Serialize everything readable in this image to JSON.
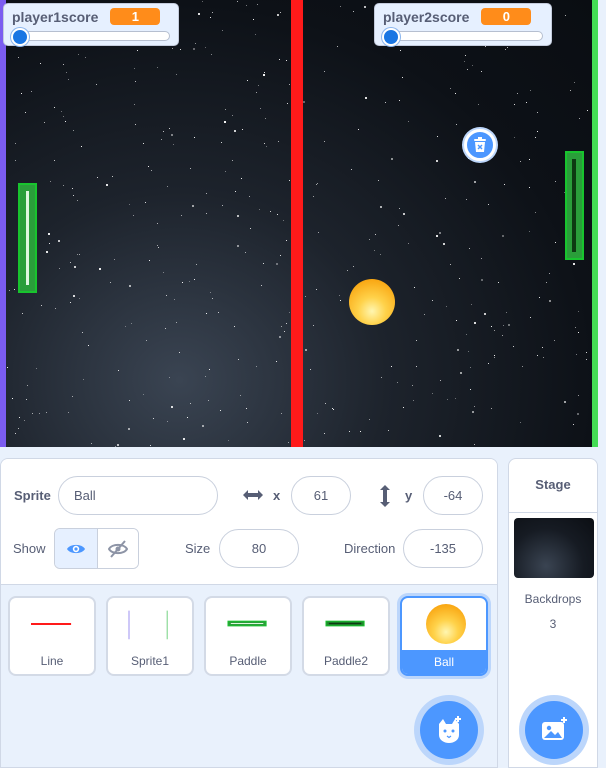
{
  "stage": {
    "monitors": [
      {
        "label": "player1score",
        "value": "1"
      },
      {
        "label": "player2score",
        "value": "0"
      }
    ],
    "sprites_on_stage": [
      "Line",
      "Paddle",
      "Paddle2",
      "Ball"
    ]
  },
  "sprite_info": {
    "sprite_label": "Sprite",
    "sprite_name": "Ball",
    "x_label": "x",
    "x_value": "61",
    "y_label": "y",
    "y_value": "-64",
    "show_label": "Show",
    "size_label": "Size",
    "size_value": "80",
    "direction_label": "Direction",
    "direction_value": "-135"
  },
  "sprites": [
    {
      "name": "Line",
      "selected": false
    },
    {
      "name": "Sprite1",
      "selected": false
    },
    {
      "name": "Paddle",
      "selected": false
    },
    {
      "name": "Paddle2",
      "selected": false
    },
    {
      "name": "Ball",
      "selected": true
    }
  ],
  "stage_pane": {
    "title": "Stage",
    "backdrops_label": "Backdrops",
    "backdrops_count": "3"
  },
  "icons": {
    "x_arrow": "horizontal-arrows-icon",
    "y_arrow": "vertical-arrows-icon",
    "show": "eye-icon",
    "hide": "eye-slash-icon",
    "delete": "trash-icon",
    "add_sprite": "cat-add-icon",
    "add_backdrop": "image-add-icon"
  },
  "colors": {
    "accent": "#4c97ff",
    "monitor_value": "#ff8c1a",
    "center_line": "#ff1a1a",
    "paddle": "#18c42e"
  }
}
